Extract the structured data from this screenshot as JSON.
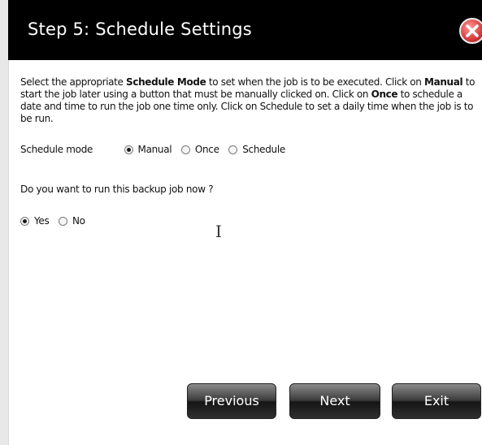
{
  "dialog": {
    "title": "Step 5: Schedule Settings"
  },
  "description": {
    "part1": "Select the appropriate ",
    "bold1": "Schedule Mode",
    "part2": " to set when the job is to be executed. Click on ",
    "bold2": "Manual",
    "part3": " to start the job later using a button that must be manually clicked on. Click on ",
    "bold3": "Once",
    "part4": " to schedule a date and time to run the job one time only. Click on Schedule to set a daily time when the job is to be run."
  },
  "schedule_mode": {
    "label": "Schedule mode",
    "options": [
      {
        "label": "Manual",
        "checked": true
      },
      {
        "label": "Once",
        "checked": false
      },
      {
        "label": "Schedule",
        "checked": false
      }
    ]
  },
  "run_now": {
    "question": "Do you want to run this backup job now ?",
    "options": [
      {
        "label": "Yes",
        "checked": true
      },
      {
        "label": "No",
        "checked": false
      }
    ]
  },
  "buttons": {
    "previous": "Previous",
    "next": "Next",
    "exit": "Exit"
  },
  "colors": {
    "titlebar": "#000000",
    "close_red": "#d63b3b"
  },
  "icons": {
    "close": "close-icon",
    "cursor": "text-cursor-icon"
  }
}
